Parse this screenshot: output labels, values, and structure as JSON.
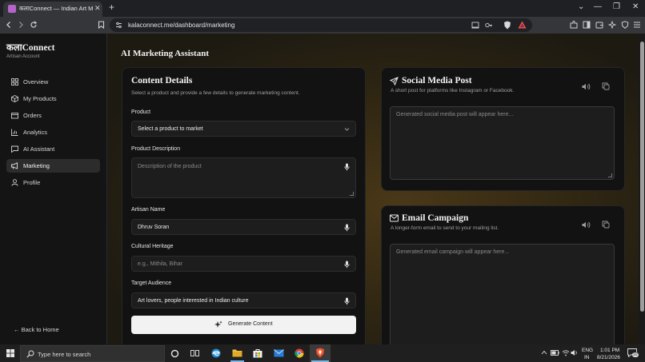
{
  "browser": {
    "tab_title": "कलाConnect — Indian Art Marketplace",
    "tab_close": "✕",
    "new_tab": "+",
    "url": "kalaconnect.me/dashboard/marketing",
    "window_min": "—",
    "window_restore": "❐",
    "window_close": "✕",
    "tab_list": "⌄"
  },
  "sidebar": {
    "brand": "कलाConnect",
    "brand_sub": "Artisan Account",
    "items": [
      {
        "label": "Overview",
        "icon": "overview-icon"
      },
      {
        "label": "My Products",
        "icon": "package-icon"
      },
      {
        "label": "Orders",
        "icon": "orders-icon"
      },
      {
        "label": "Analytics",
        "icon": "chart-icon"
      },
      {
        "label": "AI Assistant",
        "icon": "chat-icon"
      },
      {
        "label": "Marketing",
        "icon": "megaphone-icon",
        "active": true
      },
      {
        "label": "Profile",
        "icon": "user-icon"
      }
    ],
    "back": "← Back to Home"
  },
  "page": {
    "title": "AI Marketing Assistant"
  },
  "content_details": {
    "title": "Content Details",
    "subtitle": "Select a product and provide a few details to generate marketing content.",
    "product_label": "Product",
    "product_value": "Select a product to market",
    "description_label": "Product Description",
    "description_placeholder": "Description of the product",
    "artisan_label": "Artisan Name",
    "artisan_value": "Dhruv Soran",
    "heritage_label": "Cultural Heritage",
    "heritage_placeholder": "e.g., Mithila, Bihar",
    "audience_label": "Target Audience",
    "audience_value": "Art lovers, people interested in Indian culture",
    "generate_label": "Generate Content"
  },
  "social_post": {
    "title": "Social Media Post",
    "subtitle": "A short post for platforms like Instagram or Facebook.",
    "placeholder": "Generated social media post will appear here..."
  },
  "email_campaign": {
    "title": "Email Campaign",
    "subtitle": "A longer-form email to send to your mailing list.",
    "placeholder": "Generated email campaign will appear here..."
  },
  "taskbar": {
    "search_placeholder": "Type here to search",
    "lang_top": "ENG",
    "lang_bottom": "IN",
    "time": "1:01 PM",
    "date": "8/21/2026",
    "notifications": "10"
  },
  "colors": {
    "accent_brave": "#fb542b",
    "main_bg_glow": "#4a3818"
  }
}
